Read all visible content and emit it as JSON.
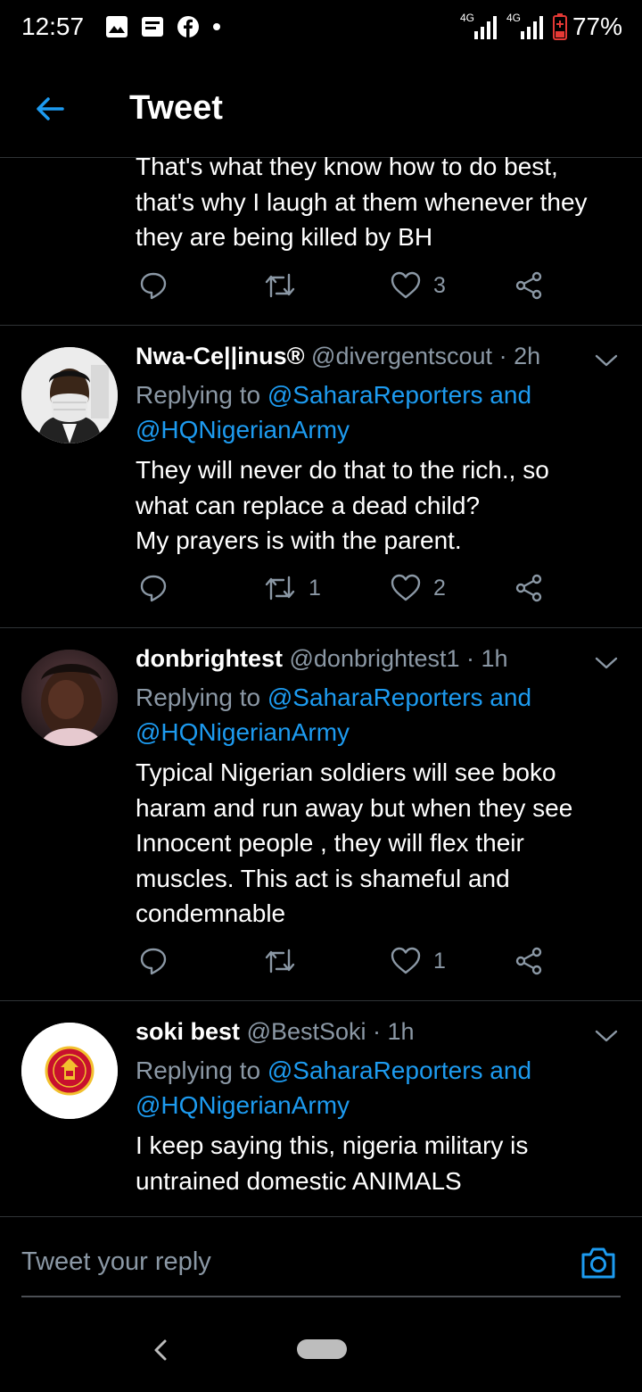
{
  "status_bar": {
    "time": "12:57",
    "icons": [
      "gallery-icon",
      "message-icon",
      "facebook-icon",
      "dot-icon"
    ],
    "network_1": "4G",
    "network_2": "4G",
    "battery": "77%"
  },
  "header": {
    "title": "Tweet",
    "back_icon": "arrow-left-icon"
  },
  "tweets": [
    {
      "partial": true,
      "lines": [
        "That's what they know how to do best,",
        "that's why I laugh at them whenever they",
        "they are being killed by BH"
      ],
      "replies": "",
      "retweets": "",
      "likes": "3"
    },
    {
      "display_name": "Nwa-Ce||inus®",
      "handle": "@divergentscout",
      "time": "· 2h",
      "replying_prefix": "Replying to",
      "replying_to_1": "@SaharaReporters and",
      "replying_to_2": "@HQNigerianArmy",
      "lines": [
        "They will never do that to the rich., so",
        "what can replace a dead child?",
        "My prayers is with the parent."
      ],
      "replies": "",
      "retweets": "1",
      "likes": "2"
    },
    {
      "display_name": "donbrightest",
      "handle": "@donbrightest1",
      "time": "· 1h",
      "replying_prefix": "Replying to",
      "replying_to_1": "@SaharaReporters and",
      "replying_to_2": "@HQNigerianArmy",
      "lines": [
        "Typical Nigerian soldiers will see boko",
        "haram and run away but when they see",
        "Innocent people , they will flex their",
        "muscles. This act is shameful and",
        "condemnable"
      ],
      "replies": "",
      "retweets": "",
      "likes": "1"
    },
    {
      "display_name": "soki best",
      "handle": "@BestSoki",
      "time": "· 1h",
      "replying_prefix": "Replying to",
      "replying_to_1": "@SaharaReporters and",
      "replying_to_2": "@HQNigerianArmy",
      "lines": [
        "I keep saying this, nigeria military is",
        "untrained domestic ANIMALS"
      ]
    }
  ],
  "composer": {
    "placeholder": "Tweet your reply",
    "camera_icon": "camera-icon"
  },
  "nav": {
    "back": "back-nav-icon",
    "home": "home-pill-icon"
  },
  "colors": {
    "background": "#000000",
    "accent": "#1d9bf0",
    "muted": "#8b98a5",
    "divider": "#2f3336",
    "battery": "#e53935"
  }
}
